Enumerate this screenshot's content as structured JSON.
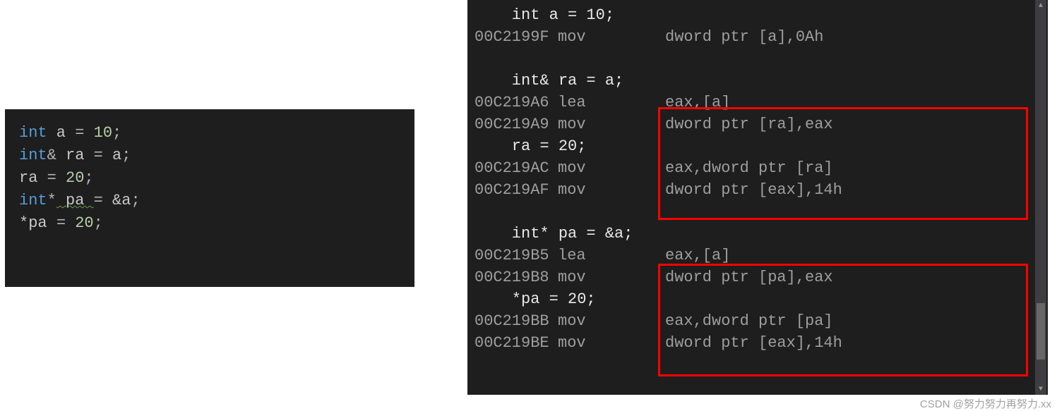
{
  "left_code": {
    "l1_kw": "int",
    "l1_var": " a ",
    "l1_eq": "= ",
    "l1_num": "10",
    "l1_semi": ";",
    "l2": "",
    "l3_kw": "int",
    "l3_amp": "&",
    "l3_var": " ra ",
    "l3_eq": "= ",
    "l3_rhs": "a",
    "l3_semi": ";",
    "l4_var": "ra ",
    "l4_eq": "= ",
    "l4_num": "20",
    "l4_semi": ";",
    "l5": "",
    "l6_kw": "int",
    "l6_star": "*",
    "l6_var": " pa ",
    "l6_eq": "= ",
    "l6_rhs": "&a",
    "l6_semi": ";",
    "l7_lhs": "*pa ",
    "l7_eq": "= ",
    "l7_num": "20",
    "l7_semi": ";"
  },
  "disasm": {
    "r1_src": "    int a = 10;",
    "r2_addr": "00C2199F",
    "r2_mnem": "mov",
    "r2_oper": "dword ptr [a],0Ah",
    "r3_blank": " ",
    "r4_src": "    int& ra = a;",
    "r5_addr": "00C219A6",
    "r5_mnem": "lea",
    "r5_oper": "eax,[a]",
    "r6_addr": "00C219A9",
    "r6_mnem": "mov",
    "r6_oper": "dword ptr [ra],eax",
    "r7_src": "    ra = 20;",
    "r8_addr": "00C219AC",
    "r8_mnem": "mov",
    "r8_oper": "eax,dword ptr [ra]",
    "r9_addr": "00C219AF",
    "r9_mnem": "mov",
    "r9_oper": "dword ptr [eax],14h",
    "r10_blank": " ",
    "r11_src": "    int* pa = &a;",
    "r12_addr": "00C219B5",
    "r12_mnem": "lea",
    "r12_oper": "eax,[a]",
    "r13_addr": "00C219B8",
    "r13_mnem": "mov",
    "r13_oper": "dword ptr [pa],eax",
    "r14_src": "    *pa = 20;",
    "r15_addr": "00C219BB",
    "r15_mnem": "mov",
    "r15_oper": "eax,dword ptr [pa]",
    "r16_addr": "00C219BE",
    "r16_mnem": "mov",
    "r16_oper": "dword ptr [eax],14h"
  },
  "watermark": "CSDN @努力努力再努力.xx"
}
